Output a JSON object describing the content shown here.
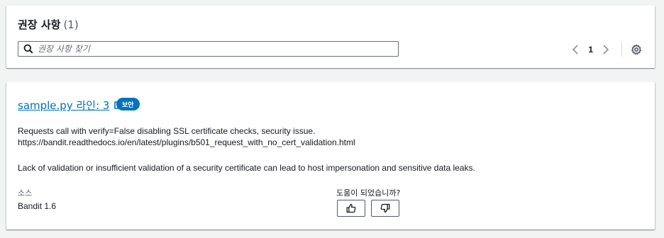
{
  "header": {
    "title": "권장 사항",
    "count": "(1)"
  },
  "search": {
    "placeholder": "권장 사항 찾기"
  },
  "pagination": {
    "current_page": "1"
  },
  "result": {
    "file_link": "sample.py 라인: 3",
    "badge": "보안",
    "description_line1": "Requests call with verify=False disabling SSL certificate checks, security issue.",
    "description_line2": "https://bandit.readthedocs.io/en/latest/plugins/b501_request_with_no_cert_validation.html",
    "description_line3": "Lack of validation or insufficient validation of a security certificate can lead to host impersonation and sensitive data leaks.",
    "source_label": "소스",
    "source_value": "Bandit 1.6",
    "feedback_label": "도움이 되었습니까?"
  },
  "colors": {
    "link": "#0073bb",
    "badge_bg": "#0073bb",
    "page_bg": "#f2f3f3"
  }
}
